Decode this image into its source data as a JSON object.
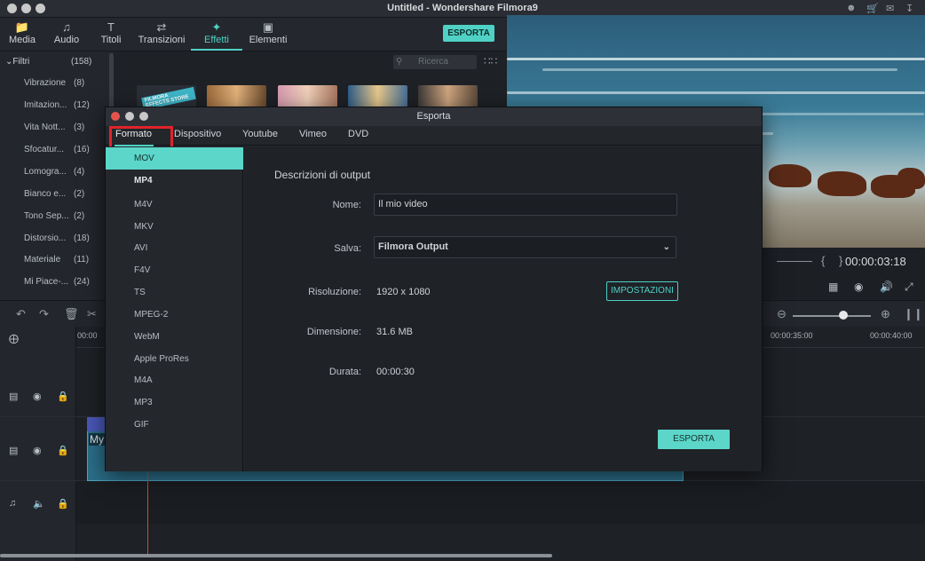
{
  "app": {
    "title": "Untitled - Wondershare Filmora9"
  },
  "topnav": {
    "tabs": [
      {
        "label": "Media",
        "icon": "folder-icon"
      },
      {
        "label": "Audio",
        "icon": "music-note-icon"
      },
      {
        "label": "Titoli",
        "icon": "text-icon"
      },
      {
        "label": "Transizioni",
        "icon": "transition-icon"
      },
      {
        "label": "Effetti",
        "icon": "effects-icon"
      },
      {
        "label": "Elementi",
        "icon": "image-icon"
      }
    ],
    "active_tab": "Effetti",
    "export_label": "ESPORTA",
    "accent_color": "#4fd1c5"
  },
  "filters": {
    "header": "Filtri",
    "count": "(158)",
    "items": [
      {
        "label": "Vibrazione",
        "count": "(8)"
      },
      {
        "label": "Imitazion...",
        "count": "(12)"
      },
      {
        "label": "Vita Nott...",
        "count": "(3)"
      },
      {
        "label": "Sfocatur...",
        "count": "(16)"
      },
      {
        "label": "Lomogra...",
        "count": "(4)"
      },
      {
        "label": "Bianco e...",
        "count": "(2)"
      },
      {
        "label": "Tono Sep...",
        "count": "(2)"
      },
      {
        "label": "Distorsio...",
        "count": "(18)"
      },
      {
        "label": "Materiale",
        "count": "(11)"
      },
      {
        "label": "Mi Piace-...",
        "count": "(24)"
      }
    ]
  },
  "effects": {
    "search_placeholder": "Ricerca",
    "thumb_text": "FILMORA EFFECTS STORE"
  },
  "preview": {
    "timecode": "00:00:03:18",
    "brace": "{ }"
  },
  "timeline": {
    "ruler": [
      "00:00",
      "00:00:35:00",
      "00:00:40:00"
    ],
    "clip_label": "My"
  },
  "export_dialog": {
    "title": "Esporta",
    "tabs": [
      "Formato",
      "Dispositivo",
      "Youtube",
      "Vimeo",
      "DVD"
    ],
    "active_tab": "Formato",
    "formats": [
      "MOV",
      "MP4",
      "M4V",
      "MKV",
      "AVI",
      "F4V",
      "TS",
      "MPEG-2",
      "WebM",
      "Apple ProRes",
      "M4A",
      "MP3",
      "GIF"
    ],
    "selected_format": "MOV",
    "section_title": "Descrizioni di output",
    "name_label": "Nome:",
    "name_value": "Il mio video",
    "save_label": "Salva:",
    "save_value": "Filmora Output",
    "resolution_label": "Risoluzione:",
    "resolution_value": "1920 x 1080",
    "settings_button": "IMPOSTAZIONI",
    "size_label": "Dimensione:",
    "size_value": "31.6 MB",
    "duration_label": "Durata:",
    "duration_value": "00:00:30",
    "export_button": "ESPORTA"
  }
}
